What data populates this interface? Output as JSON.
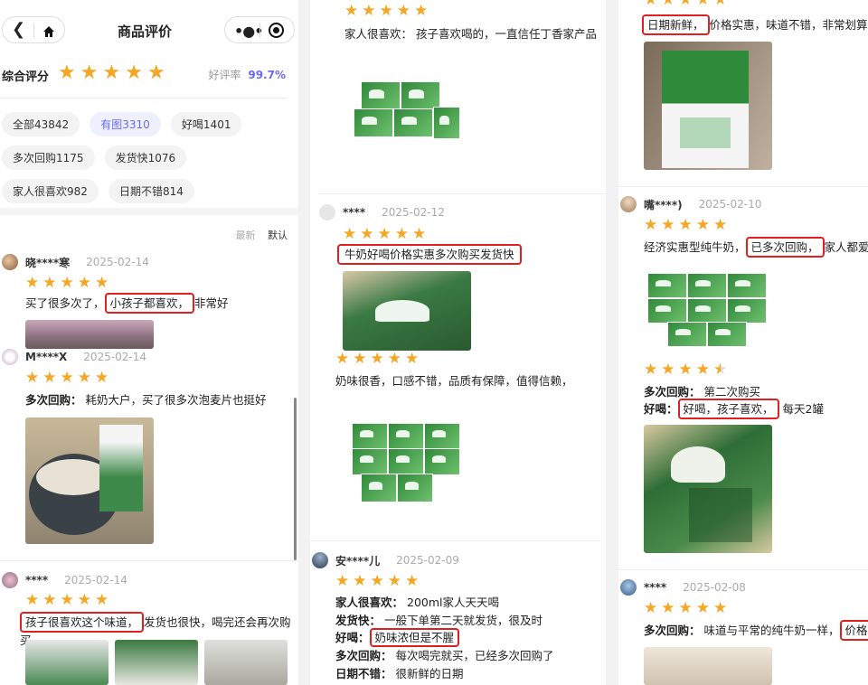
{
  "header": {
    "title": "商品评价"
  },
  "summary": {
    "rating_label": "综合评分",
    "good_rate_label": "好评率",
    "good_rate_value": "99.7%"
  },
  "tags": [
    {
      "label": "全部43842",
      "active": false
    },
    {
      "label": "有图3310",
      "active": true
    },
    {
      "label": "好喝1401",
      "active": false
    },
    {
      "label": "多次回购1175",
      "active": false
    },
    {
      "label": "发货快1076",
      "active": false
    },
    {
      "label": "家人很喜欢982",
      "active": false
    },
    {
      "label": "日期不错814",
      "active": false
    }
  ],
  "sort": {
    "latest": "最新",
    "default": "默认"
  },
  "col1": {
    "r1": {
      "user": "晓****寒",
      "date": "2025-02-14",
      "text_a": "买了很多次了，",
      "text_hl": "小孩子都喜欢，",
      "text_b": "非常好"
    },
    "r2": {
      "user": "M****X",
      "date": "2025-02-14",
      "label": "多次回购：",
      "text": "耗奶大户，买了很多次泡麦片也挺好"
    },
    "r3": {
      "user": "****",
      "date": "2025-02-14",
      "text_hl": "孩子很喜欢这个味道，",
      "text_b": "发货也很快，喝完还会再次购买"
    }
  },
  "col2": {
    "r0": {
      "text": "家人很喜欢：  孩子喜欢喝的，一直信任丁香家产品"
    },
    "r1": {
      "user": "****",
      "date": "2025-02-12",
      "text_hl": "牛奶好喝价格实惠多次购买发货快",
      "text2": "奶味很香，口感不错，品质有保障，值得信赖，"
    },
    "r2": {
      "user": "安****儿",
      "date": "2025-02-09",
      "l1_label": "家人很喜欢：",
      "l1_text": "200ml家人天天喝",
      "l2_label": "发货快：",
      "l2_text": "一般下单第二天就发货，很及时",
      "l3_label": "好喝：",
      "l3_text": "奶味浓但是不腥",
      "l4_label": "多次回购：",
      "l4_text": "每次喝完就买，已经多次回购了",
      "l5_label": "日期不错：",
      "l5_text": "很新鲜的日期"
    }
  },
  "col3": {
    "r0": {
      "text_hl": "日期新鲜，",
      "text_b": "价格实惠，味道不错，非常划算"
    },
    "r1": {
      "user": "嘴****)",
      "date": "2025-02-10",
      "text_a": "经济实惠型纯牛奶，",
      "text_hl": "已多次回购，",
      "text_b": "家人都爱喝",
      "l1_label": "多次回购：",
      "l1_text": "第二次购买",
      "l2_label": "好喝：",
      "l2_hl": "好喝，孩子喜欢，",
      "l2_text": "每天2罐"
    },
    "r2": {
      "user": "****",
      "date": "2025-02-08",
      "label": "多次回购：",
      "text": "味道与平常的纯牛奶一样，",
      "text_hl": "价格实惠"
    }
  },
  "colors": {
    "star": "#f5a623",
    "highlight_border": "#e02020",
    "accent": "#6a6af0"
  }
}
